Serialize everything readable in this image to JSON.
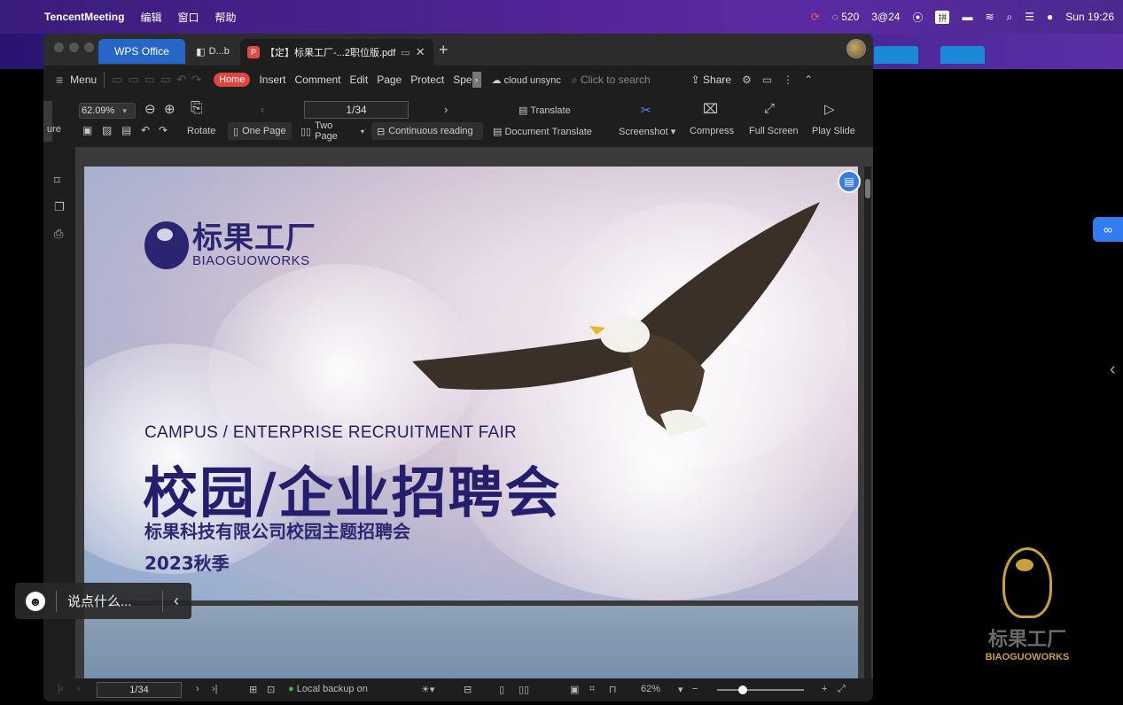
{
  "menubar": {
    "app_name": "TencentMeeting",
    "items": [
      "编辑",
      "窗口",
      "帮助"
    ],
    "status": [
      "520",
      "3@24",
      "拼",
      "Sun 19:26"
    ]
  },
  "window": {
    "tabs": {
      "wps": "WPS Office",
      "doc": "D...b",
      "pdf": "【定】标果工厂-...2职位版.pdf"
    }
  },
  "menu_row": {
    "menu": "Menu",
    "home": "Home",
    "tabs": [
      "Insert",
      "Comment",
      "Edit",
      "Page",
      "Protect",
      "Spe"
    ],
    "cloud": "cloud unsync",
    "search_placeholder": "Click to search",
    "share": "Share"
  },
  "toolbar": {
    "zoom": "62.09%",
    "page": "1/34",
    "ure": "ure",
    "rotate": "Rotate",
    "one_page": "One Page",
    "two_page": "Two Page",
    "continuous": "Continuous reading",
    "translate": "Translate",
    "document_translate": "Document Translate",
    "screenshot": "Screenshot",
    "compress": "Compress",
    "full_screen": "Full Screen",
    "play_slide": "Play Slide"
  },
  "slide": {
    "logo_cn": "标果工厂",
    "logo_en": "BIAOGUOWORKS",
    "subtitle_en": "CAMPUS /  ENTERPRISE RECRUITMENT FAIR",
    "title_cn": "校园/企业招聘会",
    "line3": "标果科技有限公司校园主题招聘会",
    "line4": "2023秋季"
  },
  "statusbar": {
    "page": "1/34",
    "backup": "Local backup on",
    "zoom": "62%"
  },
  "chat": {
    "placeholder": "说点什么..."
  },
  "brand": {
    "cn": "标果工厂",
    "en": "BIAOGUOWORKS"
  }
}
